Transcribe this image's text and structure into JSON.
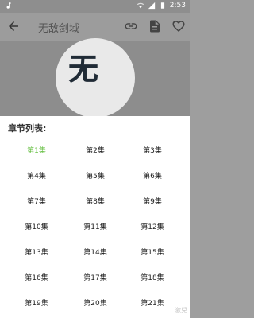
{
  "status": {
    "time": "2:53",
    "icons": [
      "music-icon",
      "wifi-icon",
      "signal-icon",
      "battery-icon"
    ]
  },
  "appbar": {
    "title": "无敌剑域",
    "actions": [
      "link-icon",
      "document-icon",
      "heart-icon"
    ]
  },
  "cover": {
    "brush_text": "无"
  },
  "sheet": {
    "heading": "章节列表:",
    "active_index": 0,
    "episodes": [
      "第1集",
      "第2集",
      "第3集",
      "第4集",
      "第5集",
      "第6集",
      "第7集",
      "第8集",
      "第9集",
      "第10集",
      "第11集",
      "第12集",
      "第13集",
      "第14集",
      "第15集",
      "第16集",
      "第17集",
      "第18集",
      "第19集",
      "第20集",
      "第21集"
    ]
  },
  "colors": {
    "accent": "#6cc24a",
    "overlay": "#8e8e8e"
  },
  "watermark": "激兒"
}
